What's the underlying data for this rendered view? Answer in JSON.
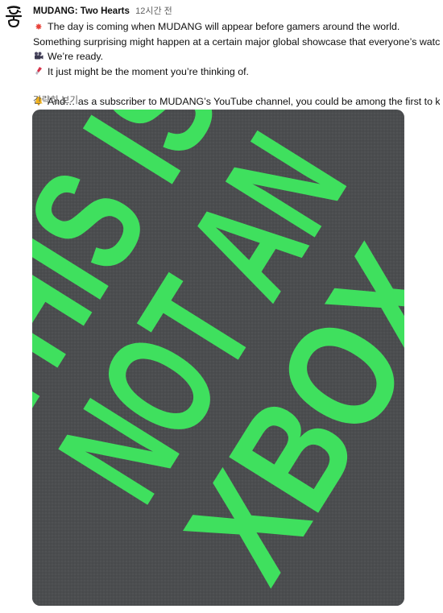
{
  "post": {
    "author": "MUDANG: Two Hearts",
    "timestamp": "12시간 전",
    "avatar_icon": "mudang-logo-icon",
    "lines": [
      {
        "icon": "collision-icon",
        "text": "The day is coming when MUDANG will appear before gamers around the world."
      },
      {
        "icon": "",
        "text": "Something surprising might happen at a certain major global showcase that everyone’s watching…"
      },
      {
        "icon": "movie-camera-icon",
        "text": "We’re ready."
      },
      {
        "icon": "lipstick-icon",
        "text": "It just might be the moment you’re thinking of."
      },
      {
        "icon": "bell-icon",
        "text": "And… as a subscriber to MUDANG’s YouTube channel, you could be among the first to know."
      }
    ],
    "read_more": "간략히 보기",
    "image": {
      "shirt_text_lines": [
        "THIS IS",
        "NOT AN",
        "XBOX"
      ],
      "shirt_color": "#4b4d4f",
      "text_color": "#3fe05e"
    }
  }
}
